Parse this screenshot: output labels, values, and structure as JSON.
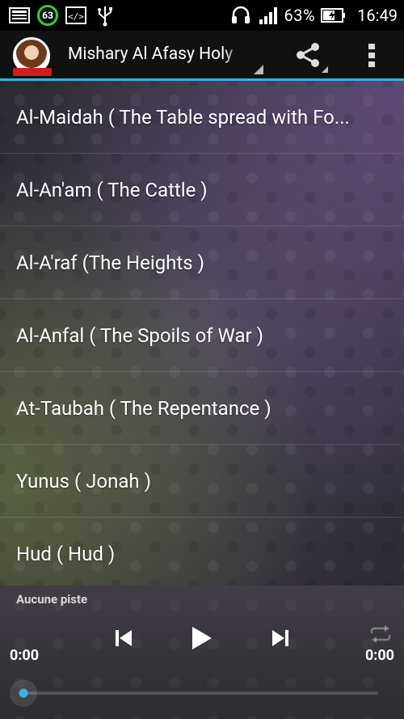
{
  "status_bar": {
    "battery_badge": "63",
    "battery_percent": "63%",
    "time": "16:49",
    "icons": [
      "gallery-icon",
      "battery-badge-icon",
      "code-icon",
      "usb-icon",
      "headset-icon",
      "signal-icon",
      "battery-icon"
    ]
  },
  "app_bar": {
    "title": "Mishary Al Afasy Holy",
    "icons": [
      "app-avatar-icon",
      "share-icon",
      "overflow-menu-icon"
    ],
    "accent_color": "#33b5e5"
  },
  "list": {
    "items": [
      "Al-Maidah ( The Table spread with Fo...",
      "Al-An'am ( The Cattle )",
      "Al-A'raf (The Heights )",
      "Al-Anfal ( The Spoils of War )",
      "At-Taubah ( The Repentance )",
      "Yunus ( Jonah )",
      "Hud ( Hud )"
    ]
  },
  "player": {
    "track_name": "Aucune piste",
    "time_elapsed": "0:00",
    "time_total": "0:00",
    "progress_percent": 0,
    "icons": [
      "previous-icon",
      "play-icon",
      "next-icon",
      "repeat-icon"
    ]
  }
}
